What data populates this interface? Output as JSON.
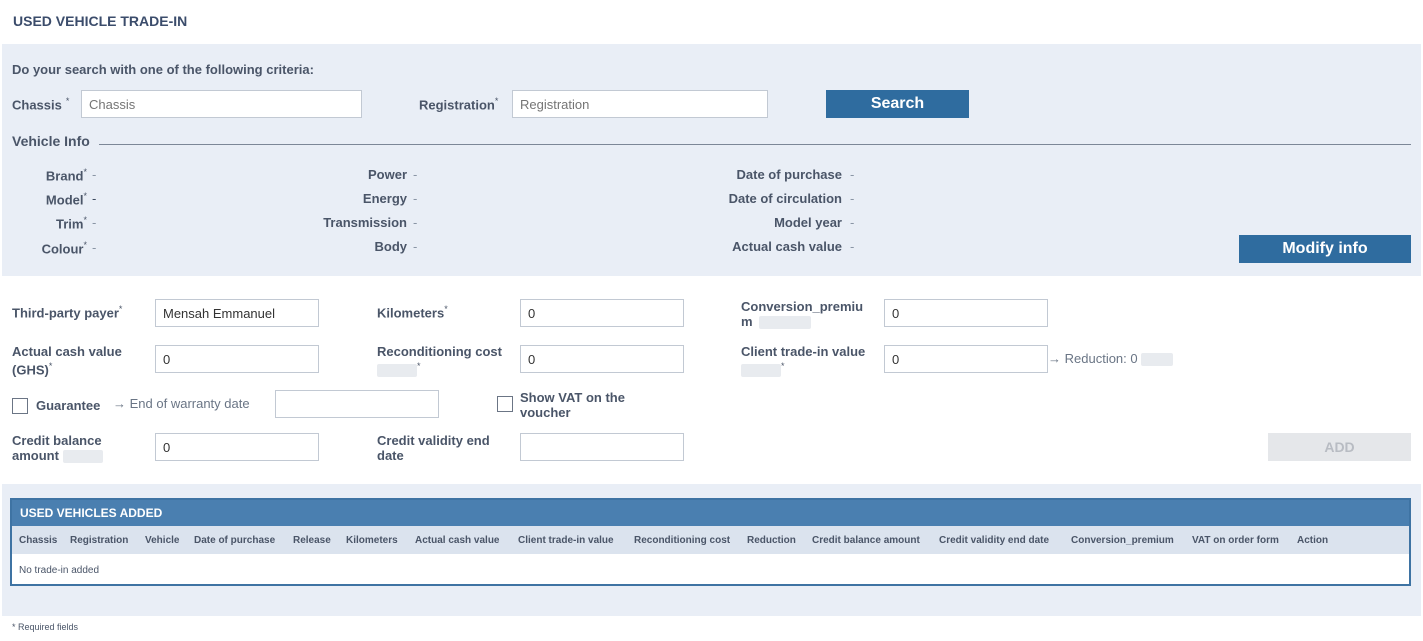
{
  "page": {
    "title": "USED VEHICLE TRADE-IN"
  },
  "search": {
    "instruction": "Do your search with one of the following criteria:",
    "chassis_label": "Chassis",
    "chassis_placeholder": "Chassis",
    "registration_label": "Registration",
    "registration_placeholder": "Registration",
    "search_button": "Search",
    "required_mark": "*"
  },
  "vehicle_info": {
    "heading": "Vehicle Info",
    "col1": [
      {
        "label": "Brand",
        "required": "*",
        "value": "-"
      },
      {
        "label": "Model",
        "required": "*",
        "value": "-"
      },
      {
        "label": "Trim",
        "required": "*",
        "value": "-"
      },
      {
        "label": "Colour",
        "required": "*",
        "value": "-"
      }
    ],
    "col2": [
      {
        "label": "Power",
        "value": "-"
      },
      {
        "label": "Energy",
        "value": "-"
      },
      {
        "label": "Transmission",
        "value": "-"
      },
      {
        "label": "Body",
        "value": "-"
      }
    ],
    "col3": [
      {
        "label": "Date of purchase",
        "value": "-"
      },
      {
        "label": "Date of circulation",
        "value": "-"
      },
      {
        "label": "Model year",
        "value": "-"
      },
      {
        "label": "Actual cash value",
        "value": "-"
      }
    ],
    "modify_button": "Modify info"
  },
  "form": {
    "third_party_payer": {
      "label": "Third-party payer",
      "required": "*",
      "value": "Mensah Emmanuel"
    },
    "kilometers": {
      "label": "Kilometers",
      "required": "*",
      "value": "0"
    },
    "conversion_premium": {
      "label_line1": "Conversion_premiu",
      "label_line2": "m",
      "value": "0"
    },
    "actual_cash_value": {
      "label_line1": "Actual cash value",
      "label_line2": "(GHS)",
      "required": "*",
      "value": "0"
    },
    "reconditioning_cost": {
      "label": "Reconditioning cost",
      "required": "*",
      "value": "0"
    },
    "client_trade_in_value": {
      "label": "Client trade-in value",
      "required": "*",
      "value": "0",
      "reduction_arrow": "→",
      "reduction_text": "Reduction: 0"
    },
    "guarantee": {
      "label": "Guarantee",
      "arrow": "→",
      "end_of_warranty_label": "End of warranty date",
      "value": ""
    },
    "show_vat": {
      "label_line1": "Show VAT on the",
      "label_line2": "voucher"
    },
    "credit_balance_amount": {
      "label_line1": "Credit balance",
      "label_line2": "amount",
      "value": "0"
    },
    "credit_validity_end_date": {
      "label_line1": "Credit validity end",
      "label_line2": "date",
      "value": ""
    },
    "add_button": "ADD"
  },
  "table": {
    "title": "USED VEHICLES ADDED",
    "columns": [
      "Chassis",
      "Registration",
      "Vehicle",
      "Date of purchase",
      "Release",
      "Kilometers",
      "Actual cash value",
      "Client trade-in value",
      "Reconditioning cost",
      "Reduction",
      "Credit balance amount",
      "Credit validity end date",
      "Conversion_premium",
      "VAT on order form",
      "Action"
    ],
    "empty_message": "No trade-in added"
  },
  "footer": {
    "note": "* Required fields"
  },
  "colors": {
    "accent": "#2f6c9f",
    "panel_bg": "#e9eef6",
    "table_header": "#4a7fb0"
  }
}
